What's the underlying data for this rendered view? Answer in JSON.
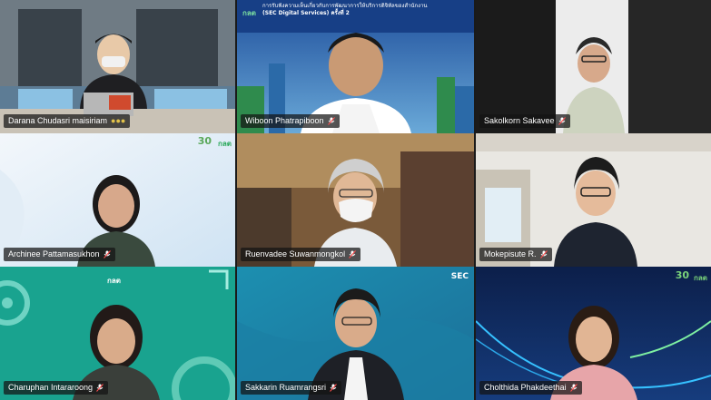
{
  "participants": [
    {
      "name": "Darana Chudasri maisiriam",
      "muted": true,
      "speaking": true
    },
    {
      "name": "Wiboon Phatrapiboon",
      "muted": true
    },
    {
      "name": "Sakolkorn Sakavee",
      "muted": true
    },
    {
      "name": "Archinee Pattamasukhon",
      "muted": true
    },
    {
      "name": "Ruenvadee Suwanmongkol",
      "muted": true
    },
    {
      "name": "Mokepisute R.",
      "muted": true
    },
    {
      "name": "Charuphan Intararoong",
      "muted": true
    },
    {
      "name": "Sakkarin Ruamrangsri",
      "muted": true
    },
    {
      "name": "Cholthida Phakdeethai",
      "muted": true
    }
  ],
  "banner": {
    "logo": "กลต",
    "line1": "การรับฟังความเห็นเกี่ยวกับการพัฒนาการให้บริการดิจิทัลของสำนักงาน",
    "line2": "(SEC Digital Services) ครั้งที่ 2"
  },
  "logos": {
    "sec_thai": "กลต",
    "sec_en": "SEC",
    "anniversary": "30"
  },
  "colors": {
    "active_outline": "#8ea2ff",
    "green_logo": "#2aa85a",
    "name_tag_bg": "#141414"
  }
}
